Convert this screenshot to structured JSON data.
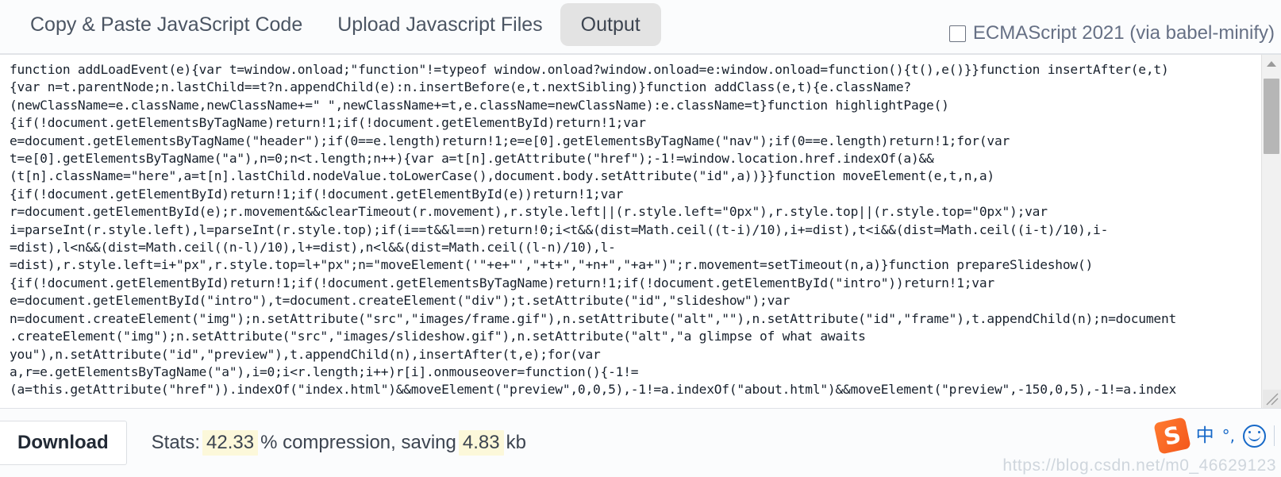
{
  "tabs": [
    {
      "label": "Copy & Paste JavaScript Code",
      "active": false
    },
    {
      "label": "Upload Javascript Files",
      "active": false
    },
    {
      "label": "Output",
      "active": true
    }
  ],
  "header": {
    "ecmascript_option_label": "ECMAScript 2021 (via babel-minify)",
    "ecmascript_checked": false
  },
  "output": {
    "code": "function addLoadEvent(e){var t=window.onload;\"function\"!=typeof window.onload?window.onload=e:window.onload=function(){t(),e()}}function insertAfter(e,t)\n{var n=t.parentNode;n.lastChild==t?n.appendChild(e):n.insertBefore(e,t.nextSibling)}function addClass(e,t){e.className?\n(newClassName=e.className,newClassName+=\" \",newClassName+=t,e.className=newClassName):e.className=t}function highlightPage()\n{if(!document.getElementsByTagName)return!1;if(!document.getElementById)return!1;var\ne=document.getElementsByTagName(\"header\");if(0==e.length)return!1;e=e[0].getElementsByTagName(\"nav\");if(0==e.length)return!1;for(var\nt=e[0].getElementsByTagName(\"a\"),n=0;n<t.length;n++){var a=t[n].getAttribute(\"href\");-1!=window.location.href.indexOf(a)&&\n(t[n].className=\"here\",a=t[n].lastChild.nodeValue.toLowerCase(),document.body.setAttribute(\"id\",a))}}function moveElement(e,t,n,a)\n{if(!document.getElementById)return!1;if(!document.getElementById(e))return!1;var\nr=document.getElementById(e);r.movement&&clearTimeout(r.movement),r.style.left||(r.style.left=\"0px\"),r.style.top||(r.style.top=\"0px\");var\ni=parseInt(r.style.left),l=parseInt(r.style.top);if(i==t&&l==n)return!0;i<t&&(dist=Math.ceil((t-i)/10),i+=dist),t<i&&(dist=Math.ceil((i-t)/10),i-\n=dist),l<n&&(dist=Math.ceil((n-l)/10),l+=dist),n<l&&(dist=Math.ceil((l-n)/10),l-\n=dist),r.style.left=i+\"px\",r.style.top=l+\"px\";n=\"moveElement('\"+e+\"',\"+t+\",\"+n+\",\"+a+\")\";r.movement=setTimeout(n,a)}function prepareSlideshow()\n{if(!document.getElementById)return!1;if(!document.getElementsByTagName)return!1;if(!document.getElementById(\"intro\"))return!1;var\ne=document.getElementById(\"intro\"),t=document.createElement(\"div\");t.setAttribute(\"id\",\"slideshow\");var\nn=document.createElement(\"img\");n.setAttribute(\"src\",\"images/frame.gif\"),n.setAttribute(\"alt\",\"\"),n.setAttribute(\"id\",\"frame\"),t.appendChild(n);n=document\n.createElement(\"img\");n.setAttribute(\"src\",\"images/slideshow.gif\"),n.setAttribute(\"alt\",\"a glimpse of what awaits\nyou\"),n.setAttribute(\"id\",\"preview\"),t.appendChild(n),insertAfter(t,e);for(var\na,r=e.getElementsByTagName(\"a\"),i=0;i<r.length;i++)r[i].onmouseover=function(){-1!=\n(a=this.getAttribute(\"href\")).indexOf(\"index.html\")&&moveElement(\"preview\",0,0,5),-1!=a.indexOf(\"about.html\")&&moveElement(\"preview\",-150,0,5),-1!=a.index"
  },
  "scrollbar": {
    "up_arrow": "scroll-up",
    "down_arrow": "scroll-down"
  },
  "footer": {
    "download_label": "Download",
    "stats_prefix": "Stats:",
    "compression_value": "42.33",
    "compression_unit": "% compression, saving",
    "saving_value": "4.83",
    "saving_unit": "kb"
  },
  "ime": {
    "logo_letter": "S",
    "mode_label": "中",
    "punct_label": "°,"
  },
  "watermark": "https://blog.csdn.net/m0_46629123",
  "colors": {
    "page_bg": "#fbfcfd",
    "code_bg": "#ffffff",
    "active_tab_bg": "#e3e3e3",
    "highlight": "#fcf8da",
    "ime_blue": "#1769c8",
    "ime_orange": "#f4581c"
  }
}
